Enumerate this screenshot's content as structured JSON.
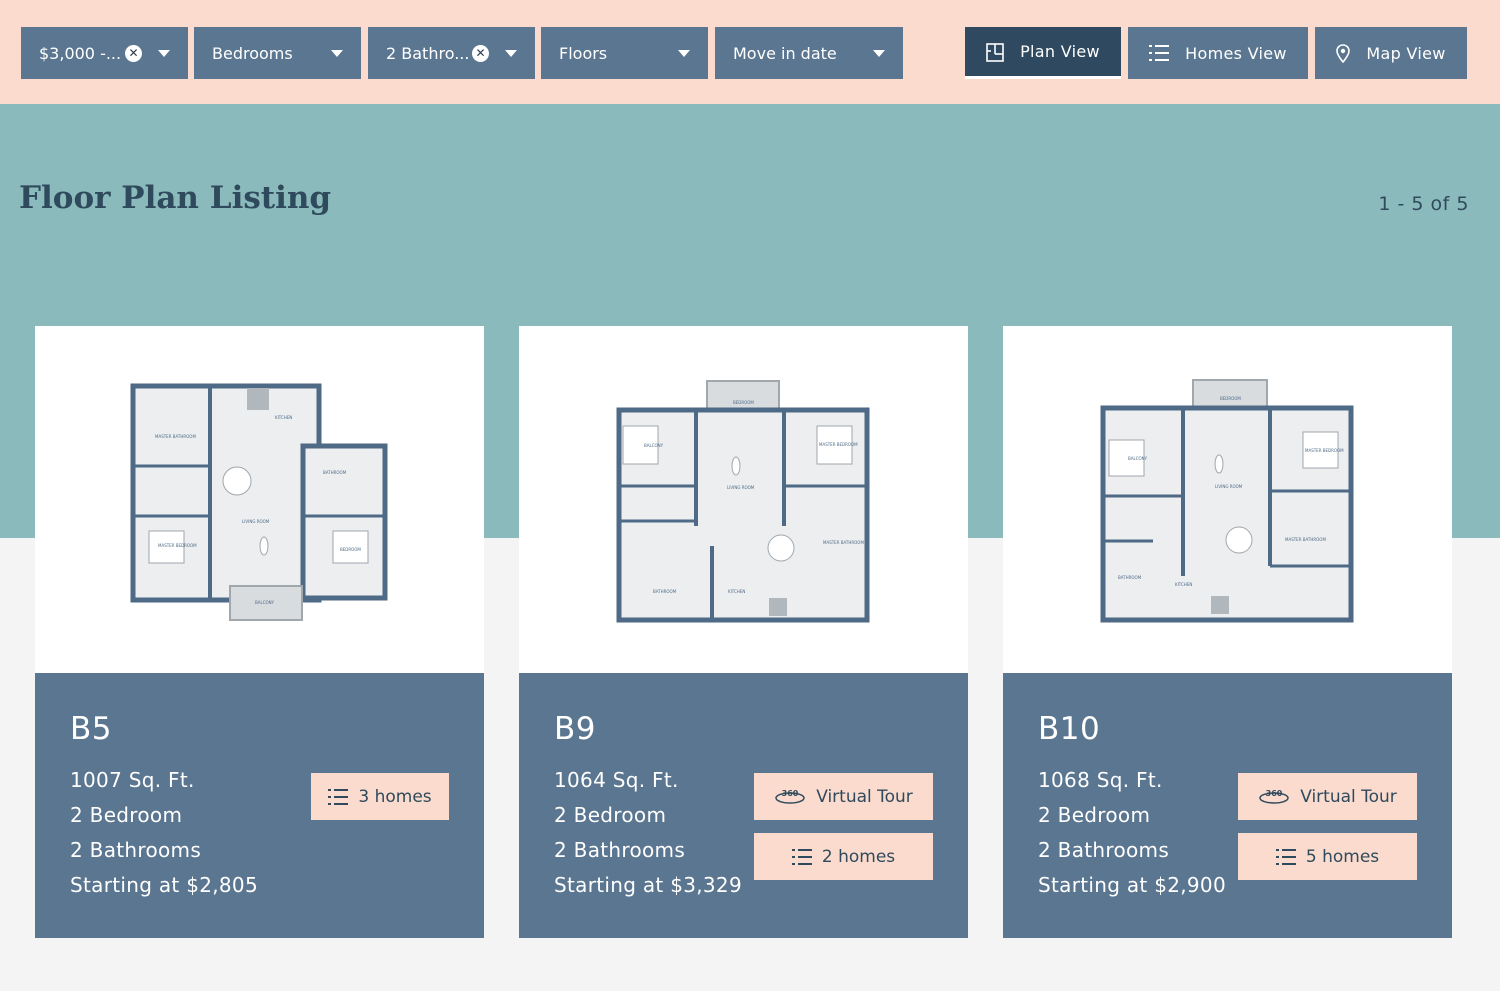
{
  "filters": [
    {
      "label": "$3,000 -...",
      "clearable": true
    },
    {
      "label": "Bedrooms",
      "clearable": false
    },
    {
      "label": "2 Bathro...",
      "clearable": true
    },
    {
      "label": "Floors",
      "clearable": false
    },
    {
      "label": "Move in date",
      "clearable": false
    }
  ],
  "views": {
    "plan": "Plan View",
    "homes": "Homes View",
    "map": "Map View"
  },
  "page": {
    "title": "Floor Plan Listing",
    "count": "1 - 5 of 5"
  },
  "colors": {
    "filter_bar": "#fadbcd",
    "hero": "#8bbabc",
    "card_info": "#5b7690",
    "active_view": "#2f4a60"
  },
  "plans": [
    {
      "name": "B5",
      "sqft": "1007 Sq. Ft.",
      "bedrooms": "2 Bedroom",
      "bathrooms": "2 Bathrooms",
      "price": "Starting at $2,805",
      "virtual_tour": null,
      "homes": "3 homes",
      "rooms": [
        "MASTER BATHROOM",
        "KITCHEN",
        "BATHROOM",
        "LIVING ROOM",
        "MASTER BEDROOM",
        "BEDROOM",
        "BALCONY"
      ]
    },
    {
      "name": "B9",
      "sqft": "1064 Sq. Ft.",
      "bedrooms": "2 Bedroom",
      "bathrooms": "2 Bathrooms",
      "price": "Starting at $3,329",
      "virtual_tour": "Virtual Tour",
      "homes": "2 homes",
      "rooms": [
        "BALCONY",
        "BEDROOM",
        "MASTER BEDROOM",
        "LIVING ROOM",
        "MASTER BATHROOM",
        "BATHROOM",
        "KITCHEN"
      ]
    },
    {
      "name": "B10",
      "sqft": "1068 Sq. Ft.",
      "bedrooms": "2 Bedroom",
      "bathrooms": "2 Bathrooms",
      "price": "Starting at $2,900",
      "virtual_tour": "Virtual Tour",
      "homes": "5 homes",
      "rooms": [
        "BALCONY",
        "BEDROOM",
        "MASTER BEDROOM",
        "LIVING ROOM",
        "MASTER BATHROOM",
        "BATHROOM",
        "KITCHEN"
      ]
    }
  ]
}
